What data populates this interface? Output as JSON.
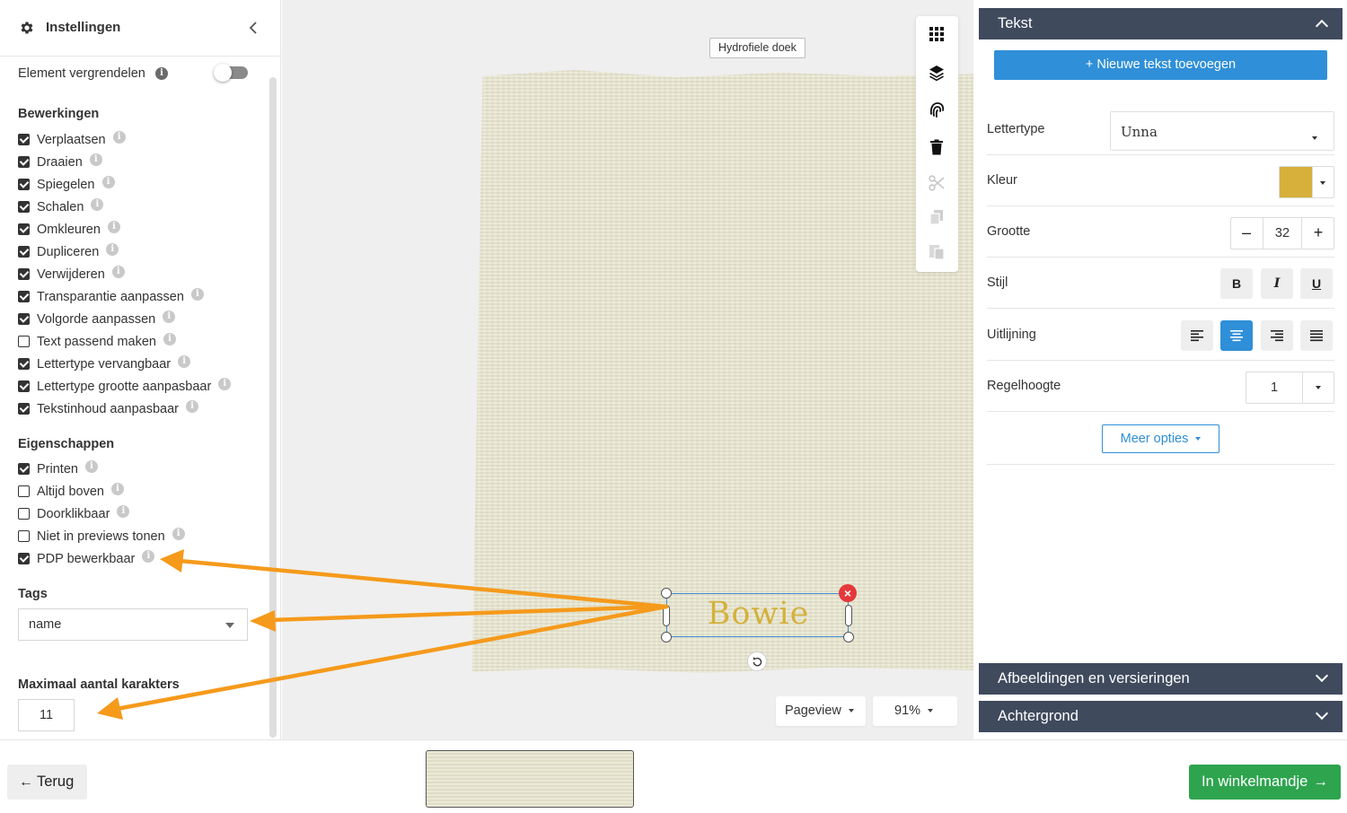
{
  "left_panel": {
    "title": "Instellingen",
    "lock_label": "Element vergrendelen",
    "lock_enabled": false,
    "bewerkingen": {
      "title": "Bewerkingen",
      "items": [
        {
          "label": "Verplaatsen",
          "checked": true
        },
        {
          "label": "Draaien",
          "checked": true
        },
        {
          "label": "Spiegelen",
          "checked": true
        },
        {
          "label": "Schalen",
          "checked": true
        },
        {
          "label": "Omkleuren",
          "checked": true
        },
        {
          "label": "Dupliceren",
          "checked": true
        },
        {
          "label": "Verwijderen",
          "checked": true
        },
        {
          "label": "Transparantie aanpassen",
          "checked": true
        },
        {
          "label": "Volgorde aanpassen",
          "checked": true
        },
        {
          "label": "Text passend maken",
          "checked": false
        },
        {
          "label": "Lettertype vervangbaar",
          "checked": true
        },
        {
          "label": "Lettertype grootte aanpasbaar",
          "checked": true
        },
        {
          "label": "Tekstinhoud aanpasbaar",
          "checked": true
        }
      ]
    },
    "eigenschappen": {
      "title": "Eigenschappen",
      "items": [
        {
          "label": "Printen",
          "checked": true
        },
        {
          "label": "Altijd boven",
          "checked": false
        },
        {
          "label": "Doorklikbaar",
          "checked": false
        },
        {
          "label": "Niet in previews tonen",
          "checked": false
        },
        {
          "label": "PDP bewerkbaar",
          "checked": true
        }
      ]
    },
    "tags": {
      "title": "Tags",
      "value": "name"
    },
    "max_chars": {
      "title": "Maximaal aantal karakters",
      "value": "11"
    }
  },
  "canvas": {
    "product_label": "Hydrofiele doek",
    "text_element": "Bowie",
    "text_color": "#d4b13c",
    "fabric_color": "#e8e6cf",
    "view_mode": "Pageview",
    "zoom": "91%",
    "toolbar_icons": [
      "grid-icon",
      "layers-icon",
      "fingerprint-icon",
      "trash-icon",
      "scissors-icon",
      "copy-icon",
      "paste-icon"
    ]
  },
  "right_panel": {
    "text_section": {
      "title": "Tekst",
      "new_text_button": "Nieuwe tekst toevoegen",
      "font": {
        "label": "Lettertype",
        "value": "Unna"
      },
      "color": {
        "label": "Kleur",
        "value": "#d6b03b"
      },
      "size": {
        "label": "Grootte",
        "value": "32",
        "minus": "–",
        "plus": "+"
      },
      "style": {
        "label": "Stijl",
        "bold": "B",
        "italic": "I",
        "underline": "U"
      },
      "align": {
        "label": "Uitlijning",
        "active": "center"
      },
      "line_height": {
        "label": "Regelhoogte",
        "value": "1"
      },
      "more_options": "Meer opties"
    },
    "images_section": {
      "title": "Afbeeldingen en versieringen"
    },
    "background_section": {
      "title": "Achtergrond"
    }
  },
  "bottom_bar": {
    "back_button": "Terug",
    "cart_button": "In winkelmandje"
  },
  "colors": {
    "accent_blue": "#2f8fd8",
    "panel_header": "#3f4a5d",
    "cart_green": "#2ea44f",
    "annotation_arrow": "#f59a1b"
  }
}
